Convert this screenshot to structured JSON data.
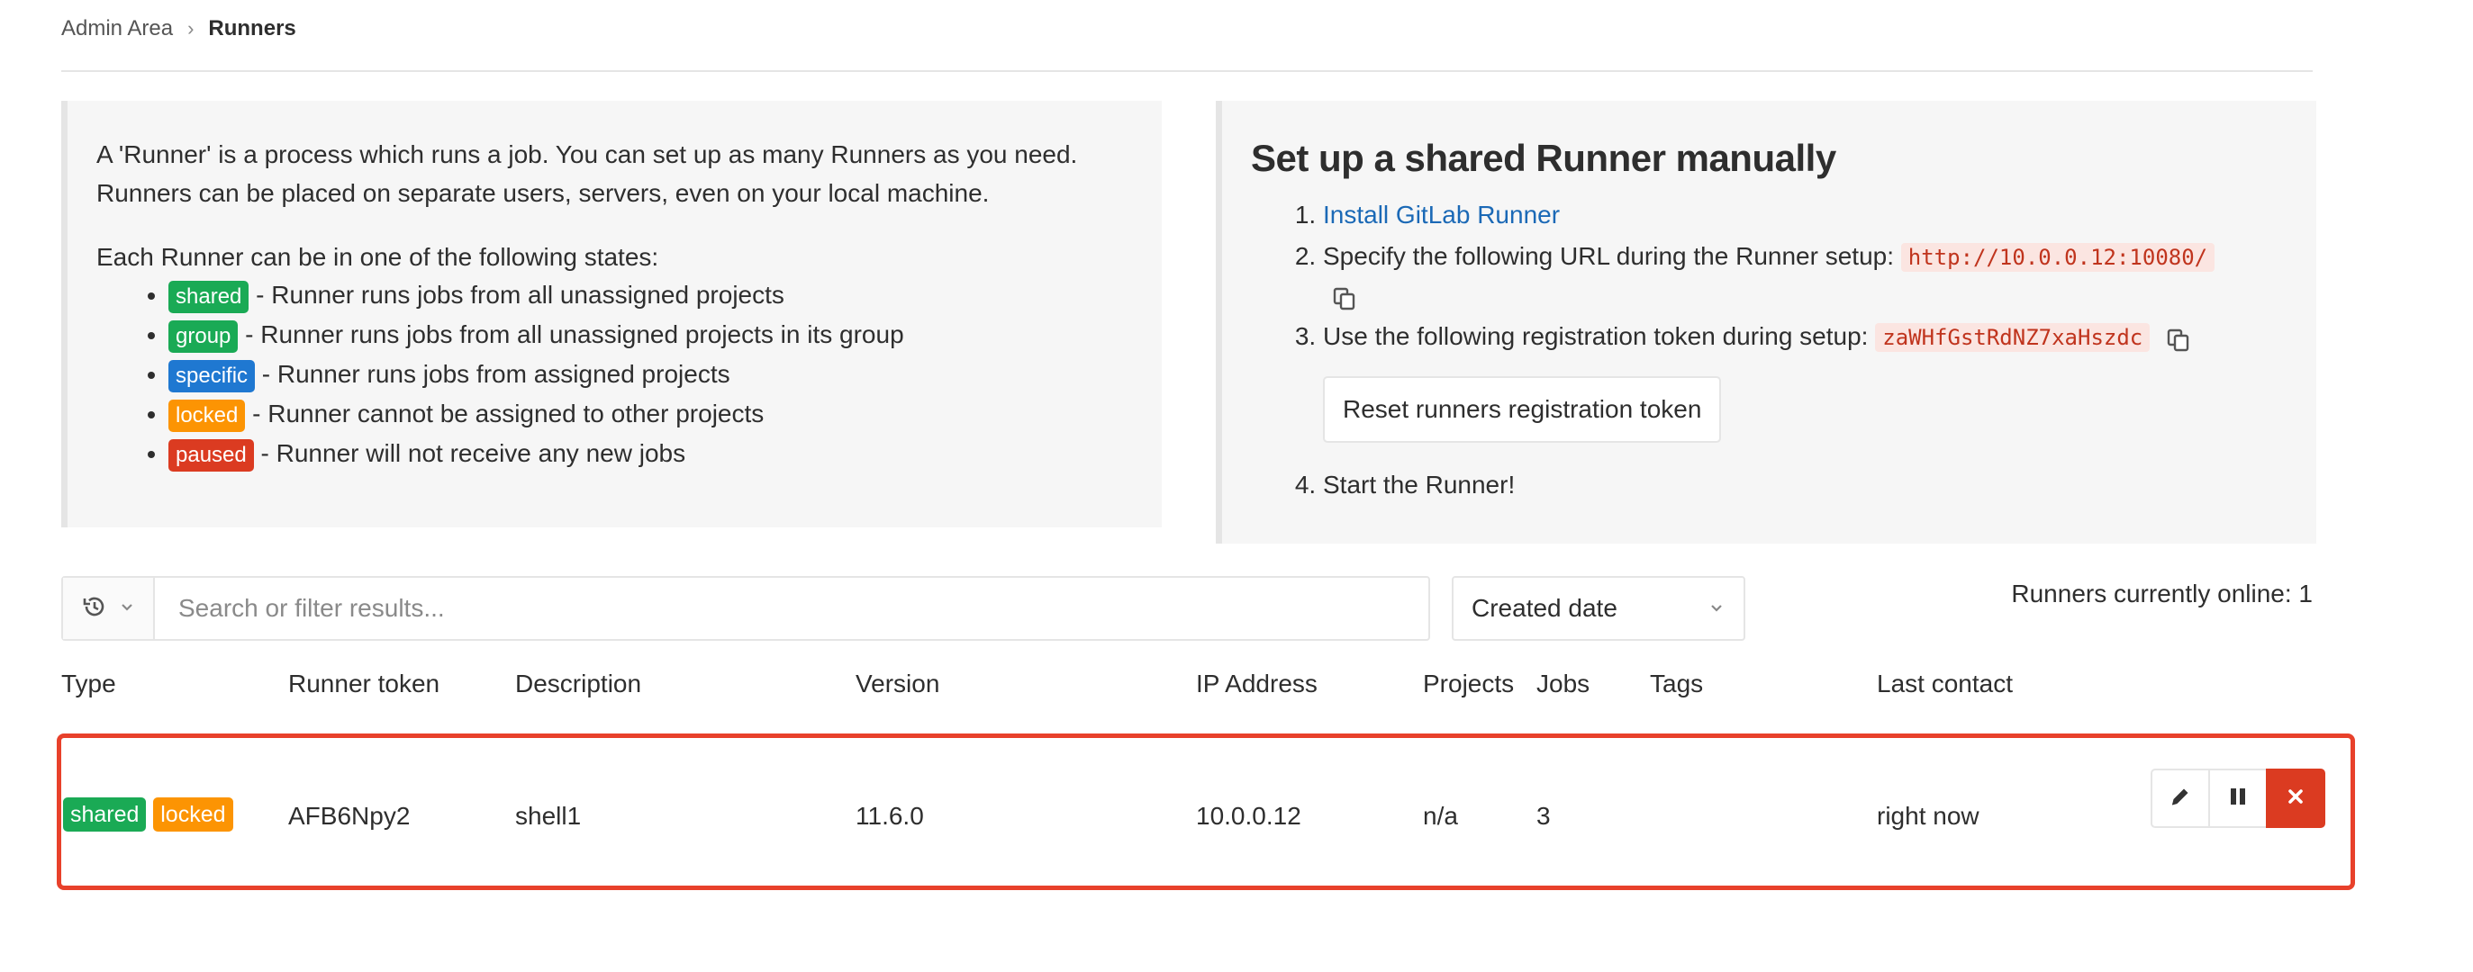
{
  "breadcrumb": {
    "parent": "Admin Area",
    "separator": "›",
    "current": "Runners"
  },
  "info": {
    "intro": "A 'Runner' is a process which runs a job. You can set up as many Runners as you need. Runners can be placed on separate users, servers, even on your local machine.",
    "states_intro": "Each Runner can be in one of the following states:",
    "states": [
      {
        "badge": "shared",
        "text": " - Runner runs jobs from all unassigned projects",
        "color": "#1aaa55"
      },
      {
        "badge": "group",
        "text": " - Runner runs jobs from all unassigned projects in its group",
        "color": "#1aaa55"
      },
      {
        "badge": "specific",
        "text": " - Runner runs jobs from assigned projects",
        "color": "#1f78d1"
      },
      {
        "badge": "locked",
        "text": " - Runner cannot be assigned to other projects",
        "color": "#fc9403"
      },
      {
        "badge": "paused",
        "text": " - Runner will not receive any new jobs",
        "color": "#db3b21"
      }
    ]
  },
  "setup": {
    "title": "Set up a shared Runner manually",
    "step1_link": "Install GitLab Runner",
    "step2_text": "Specify the following URL during the Runner setup:",
    "url": "http://10.0.0.12:10080/",
    "step3_text": "Use the following registration token during setup:",
    "token": "zaWHfGstRdNZ7xaHszdc",
    "reset_button": "Reset runners registration token",
    "step4_text": "Start the Runner!"
  },
  "filter": {
    "history_icon": "history-icon",
    "placeholder": "Search or filter results...",
    "sort_label": "Created date"
  },
  "online_status": "Runners currently online: 1",
  "table": {
    "headers": [
      "Type",
      "Runner token",
      "Description",
      "Version",
      "IP Address",
      "Projects",
      "Jobs",
      "Tags",
      "Last contact"
    ],
    "rows": [
      {
        "badges": [
          "shared",
          "locked"
        ],
        "token": "AFB6Npy2",
        "description": "shell1",
        "version": "11.6.0",
        "ip": "10.0.0.12",
        "projects": "n/a",
        "jobs": "3",
        "tags": "",
        "last_contact": "right now"
      }
    ]
  },
  "colors": {
    "highlight_border": "#e8412b",
    "link": "#1b69b6",
    "remove_button": "#db3b21"
  }
}
